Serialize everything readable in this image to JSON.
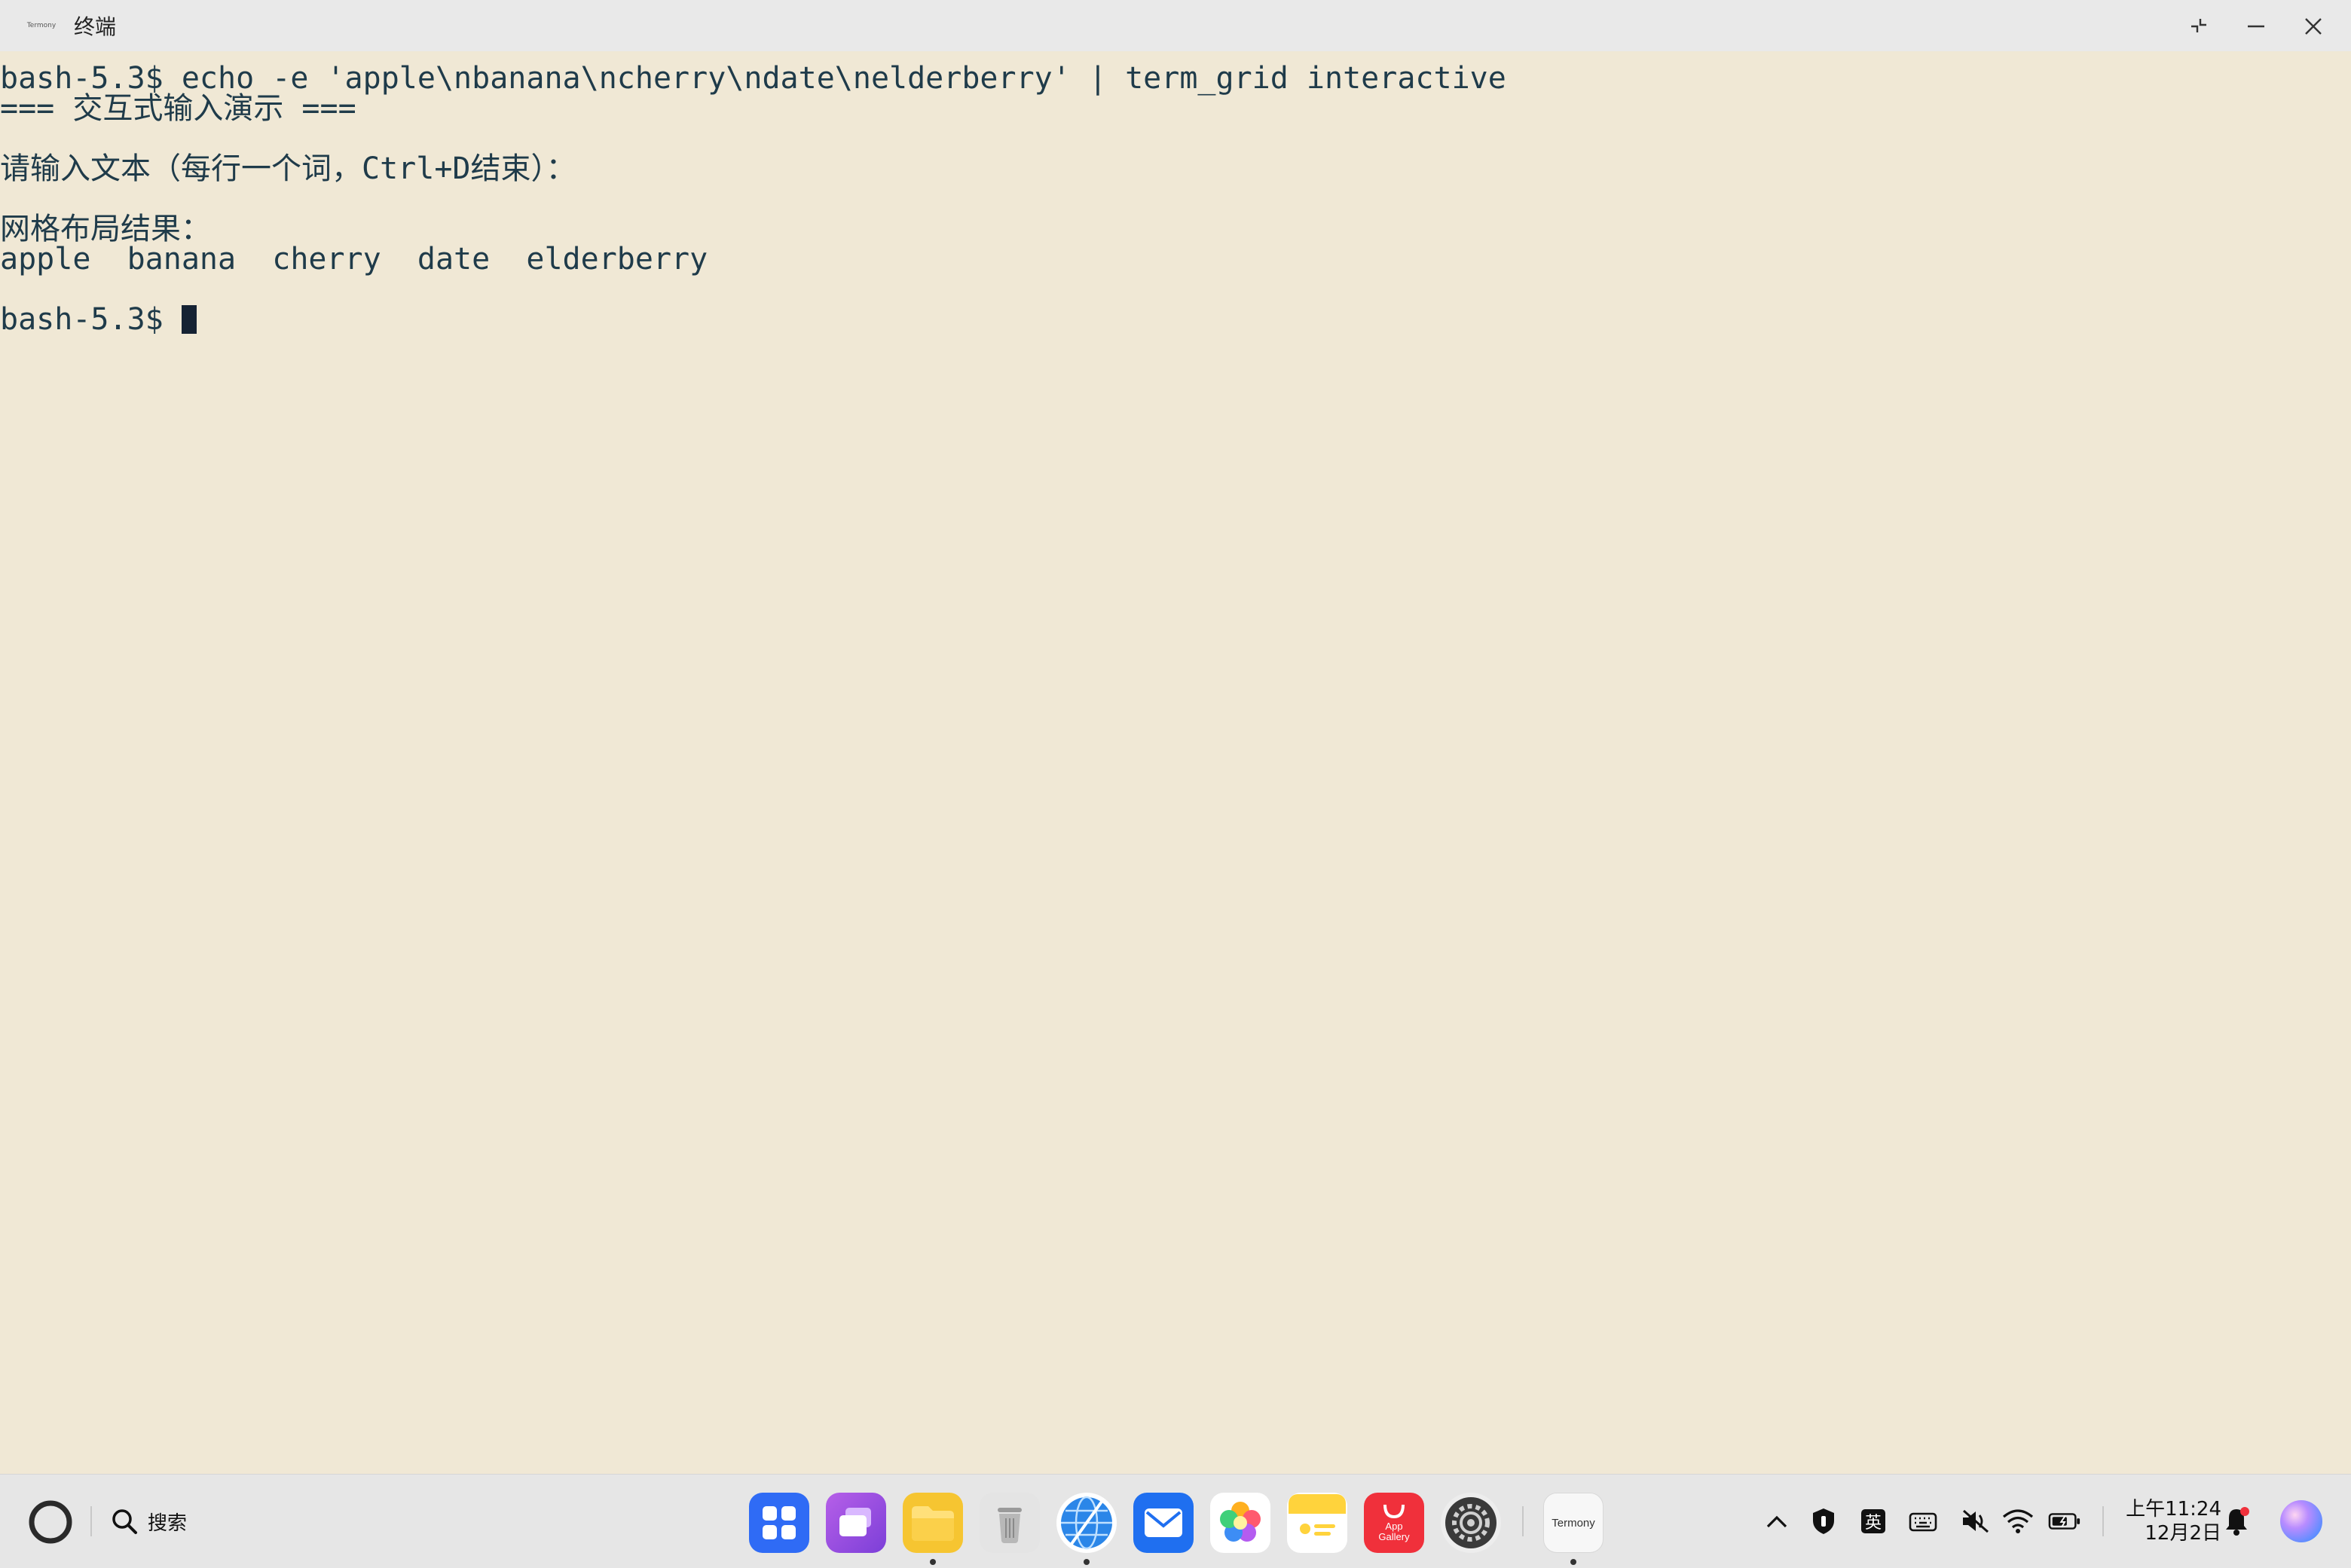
{
  "window": {
    "app_icon_label": "Termony",
    "title": "终端"
  },
  "terminal": {
    "lines": [
      "bash-5.3$ echo -e 'apple\\nbanana\\ncherry\\ndate\\nelderberry' | term_grid interactive",
      "=== 交互式输入演示 ===",
      "",
      "请输入文本（每行一个词，Ctrl+D结束）：",
      "",
      "网格布局结果：",
      "apple  banana  cherry  date  elderberry",
      "",
      "bash-5.3$ "
    ]
  },
  "taskbar": {
    "search_label": "搜索",
    "dock": [
      {
        "name": "launcher",
        "color": "#2f6bf5"
      },
      {
        "name": "multitask",
        "color": "#9b53e0"
      },
      {
        "name": "files",
        "color": "#f6c531",
        "running": true
      },
      {
        "name": "trash",
        "color": "#dcdcdc"
      },
      {
        "name": "browser",
        "color": "#2b86e8",
        "running": true
      },
      {
        "name": "mail",
        "color": "#1f6ff0"
      },
      {
        "name": "gallery",
        "color": "#ffffff"
      },
      {
        "name": "notes",
        "color": "#ffd33c"
      },
      {
        "name": "app-gallery",
        "color": "#f0303b",
        "label": "App Gallery"
      },
      {
        "name": "settings",
        "color": "#4a4a4a"
      },
      {
        "name": "termony",
        "color": "#f4f4f4",
        "label": "Termony",
        "running": true
      }
    ],
    "ime_label": "英",
    "clock_time": "上午11:24",
    "clock_date": "12月2日"
  }
}
